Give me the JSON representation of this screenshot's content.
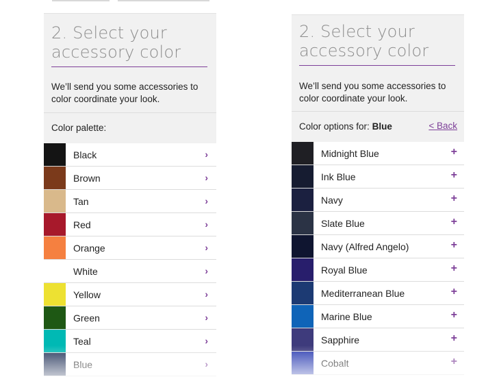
{
  "left_panel": {
    "title_line1": "2. Select your",
    "title_line2": "accessory color",
    "description": "We’ll send you some accessories to color coordinate your look.",
    "subhead_label": "Color palette:",
    "chevron_glyph": "›",
    "items": [
      {
        "label": "Black",
        "color": "#141414"
      },
      {
        "label": "Brown",
        "color": "#7b3a1b"
      },
      {
        "label": "Tan",
        "color": "#d9b98b"
      },
      {
        "label": "Red",
        "color": "#a7192b"
      },
      {
        "label": "Orange",
        "color": "#f58040"
      },
      {
        "label": "White",
        "color": "#ffffff"
      },
      {
        "label": "Yellow",
        "color": "#ede132"
      },
      {
        "label": "Green",
        "color": "#1e5814"
      },
      {
        "label": "Teal",
        "color": "#00b9b4"
      },
      {
        "label": "Blue",
        "color": "#27375c"
      }
    ]
  },
  "right_panel": {
    "title_line1": "2. Select your",
    "title_line2": "accessory color",
    "description": "We’ll send you some accessories to color coordinate your look.",
    "subhead_prefix": "Color options for:",
    "subhead_value": "Blue",
    "back_label": "<  Back",
    "plus_glyph": "+",
    "items": [
      {
        "label": "Midnight Blue",
        "color": "#1f1f24"
      },
      {
        "label": "Ink Blue",
        "color": "#161c31"
      },
      {
        "label": "Navy",
        "color": "#1b2040"
      },
      {
        "label": "Slate Blue",
        "color": "#2b3345"
      },
      {
        "label": "Navy (Alfred Angelo)",
        "color": "#0f1530"
      },
      {
        "label": "Royal Blue",
        "color": "#281e6c"
      },
      {
        "label": "Mediterranean Blue",
        "color": "#1c3a73"
      },
      {
        "label": "Marine Blue",
        "color": "#0f64b8"
      },
      {
        "label": "Sapphire",
        "color": "#3e3b7c"
      },
      {
        "label": "Cobalt",
        "color": "#3041b3"
      }
    ]
  },
  "colors": {
    "accent": "#7d3f98",
    "header_bg": "#f1f1f1",
    "title_text": "#8c8c8c"
  }
}
